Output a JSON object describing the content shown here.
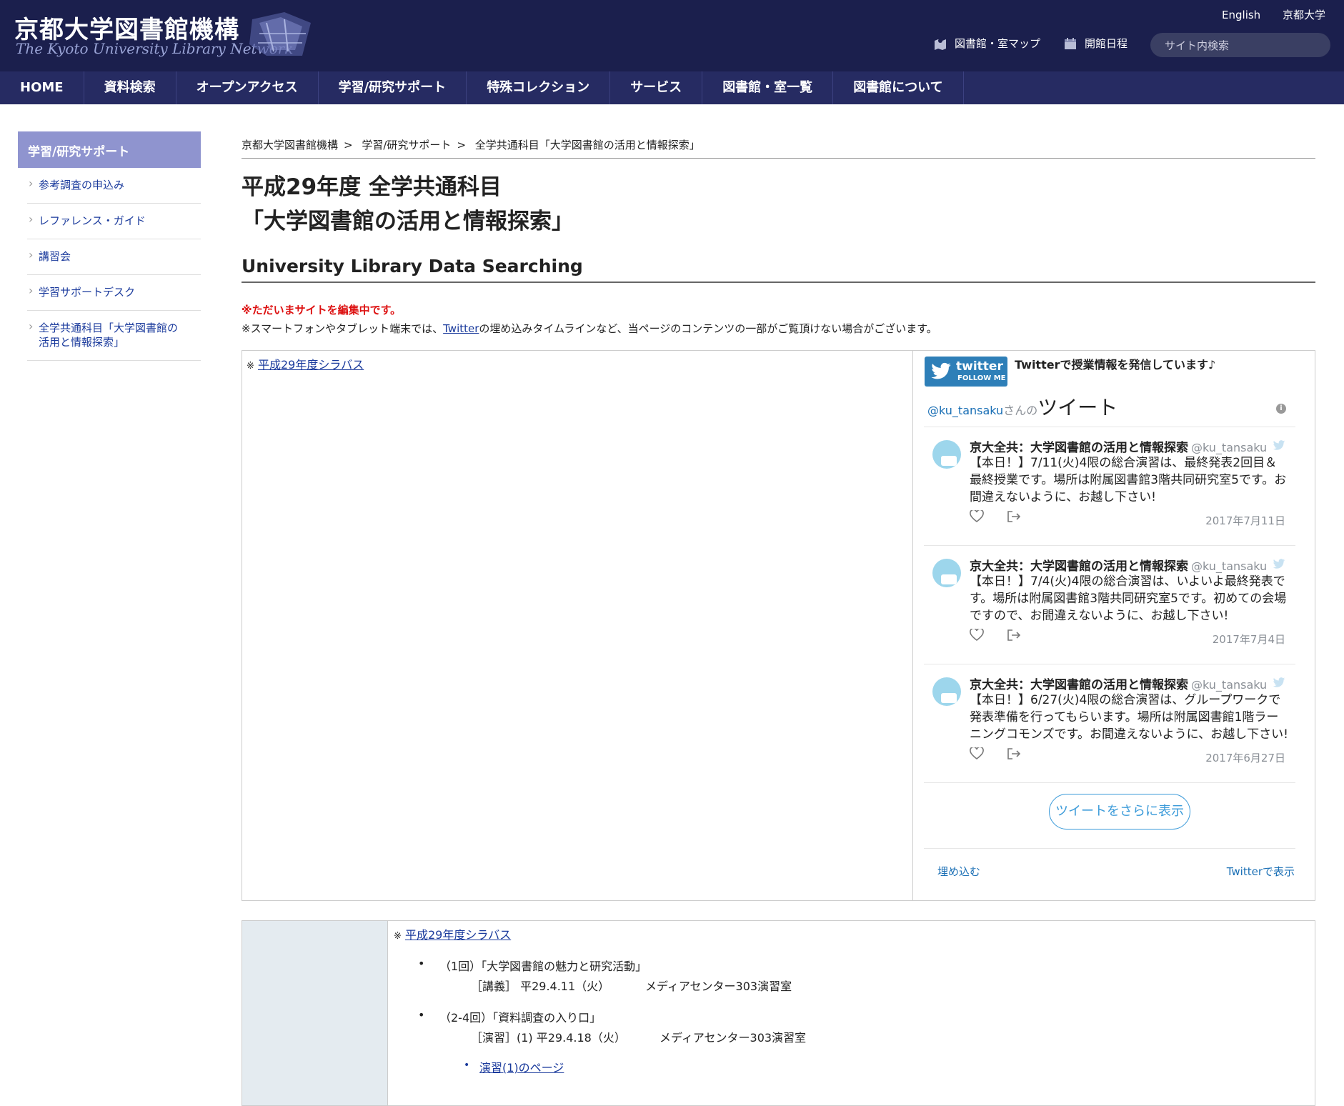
{
  "header": {
    "logo_title": "京都大学図書館機構",
    "logo_subtitle": "The Kyoto University Library Network",
    "link_english": "English",
    "link_kyoto_u": "京都大学",
    "map_label": "図書館・室マップ",
    "calendar_label": "開館日程",
    "search_placeholder": "サイト内検索"
  },
  "nav": {
    "items": [
      "HOME",
      "資料検索",
      "オープンアクセス",
      "学習/研究サポート",
      "特殊コレクション",
      "サービス",
      "図書館・室一覧",
      "図書館について"
    ]
  },
  "sidebar": {
    "heading": "学習/研究サポート",
    "items": [
      "参考調査の申込み",
      "レファレンス・ガイド",
      "講習会",
      "学習サポートデスク",
      "全学共通科目「大学図書館の活用と情報探索」"
    ]
  },
  "breadcrumb": {
    "items": [
      "京都大学図書館機構",
      "学習/研究サポート",
      "全学共通科目「大学図書館の活用と情報探索」"
    ],
    "separator": ">"
  },
  "page": {
    "title_line1": "平成29年度 全学共通科目",
    "title_line2": "「大学図書館の活用と情報探索」",
    "subtitle": "University Library Data Searching",
    "editing_notice": "※ただいまサイトを編集中です。",
    "notice_prefix": "※スマートフォンやタブレット端末では、",
    "notice_link": "Twitter",
    "notice_suffix": "の埋め込みタイムラインなど、当ページのコンテンツの一部がご覧頂けない場合がございます。",
    "syllabus_mark": "※",
    "syllabus_link": "平成29年度シラバス"
  },
  "twitter": {
    "follow_top": "twitter",
    "follow_bottom": "FOLLOW ME",
    "promo": "Twitterで授業情報を発信しています♪",
    "timeline_handle": "@ku_tansaku",
    "timeline_san": "さんの",
    "timeline_heading": "ツイート",
    "tweets": [
      {
        "name": "京大全共：大学図書館の活用と情報探索",
        "handle": "@ku_tansaku",
        "text": "【本日！】7/11(火)4限の総合演習は、最終発表2回目＆最終授業です。場所は附属図書館3階共同研究室5です。お間違えないように、お越し下さい!",
        "date": "2017年7月11日"
      },
      {
        "name": "京大全共：大学図書館の活用と情報探索",
        "handle": "@ku_tansaku",
        "text": "【本日！】7/4(火)4限の総合演習は、いよいよ最終発表です。場所は附属図書館3階共同研究室5です。初めての会場ですので、お間違えないように、お越し下さい!",
        "date": "2017年7月4日"
      },
      {
        "name": "京大全共：大学図書館の活用と情報探索",
        "handle": "@ku_tansaku",
        "text": "【本日！】6/27(火)4限の総合演習は、グループワークで発表準備を行ってもらいます。場所は附属図書館1階ラーニングコモンズです。お間違えないように、お越し下さい!",
        "date": "2017年6月27日"
      }
    ],
    "more_button": "ツイートをさらに表示",
    "embed_link": "埋め込む",
    "view_link": "Twitterで表示"
  },
  "schedule": {
    "syllabus_mark": "※",
    "syllabus_link": "平成29年度シラバス",
    "items": [
      {
        "title": "（1回）「大学図書館の魅力と研究活動」",
        "detail": "［講義］ 平29.4.11（火）",
        "room": "メディアセンター303演習室"
      },
      {
        "title": "（2-4回）「資料調査の入り口」",
        "detail": "［演習］(1) 平29.4.18（火）",
        "room": "メディアセンター303演習室"
      }
    ],
    "sub_link": "演習(1)のページ"
  }
}
